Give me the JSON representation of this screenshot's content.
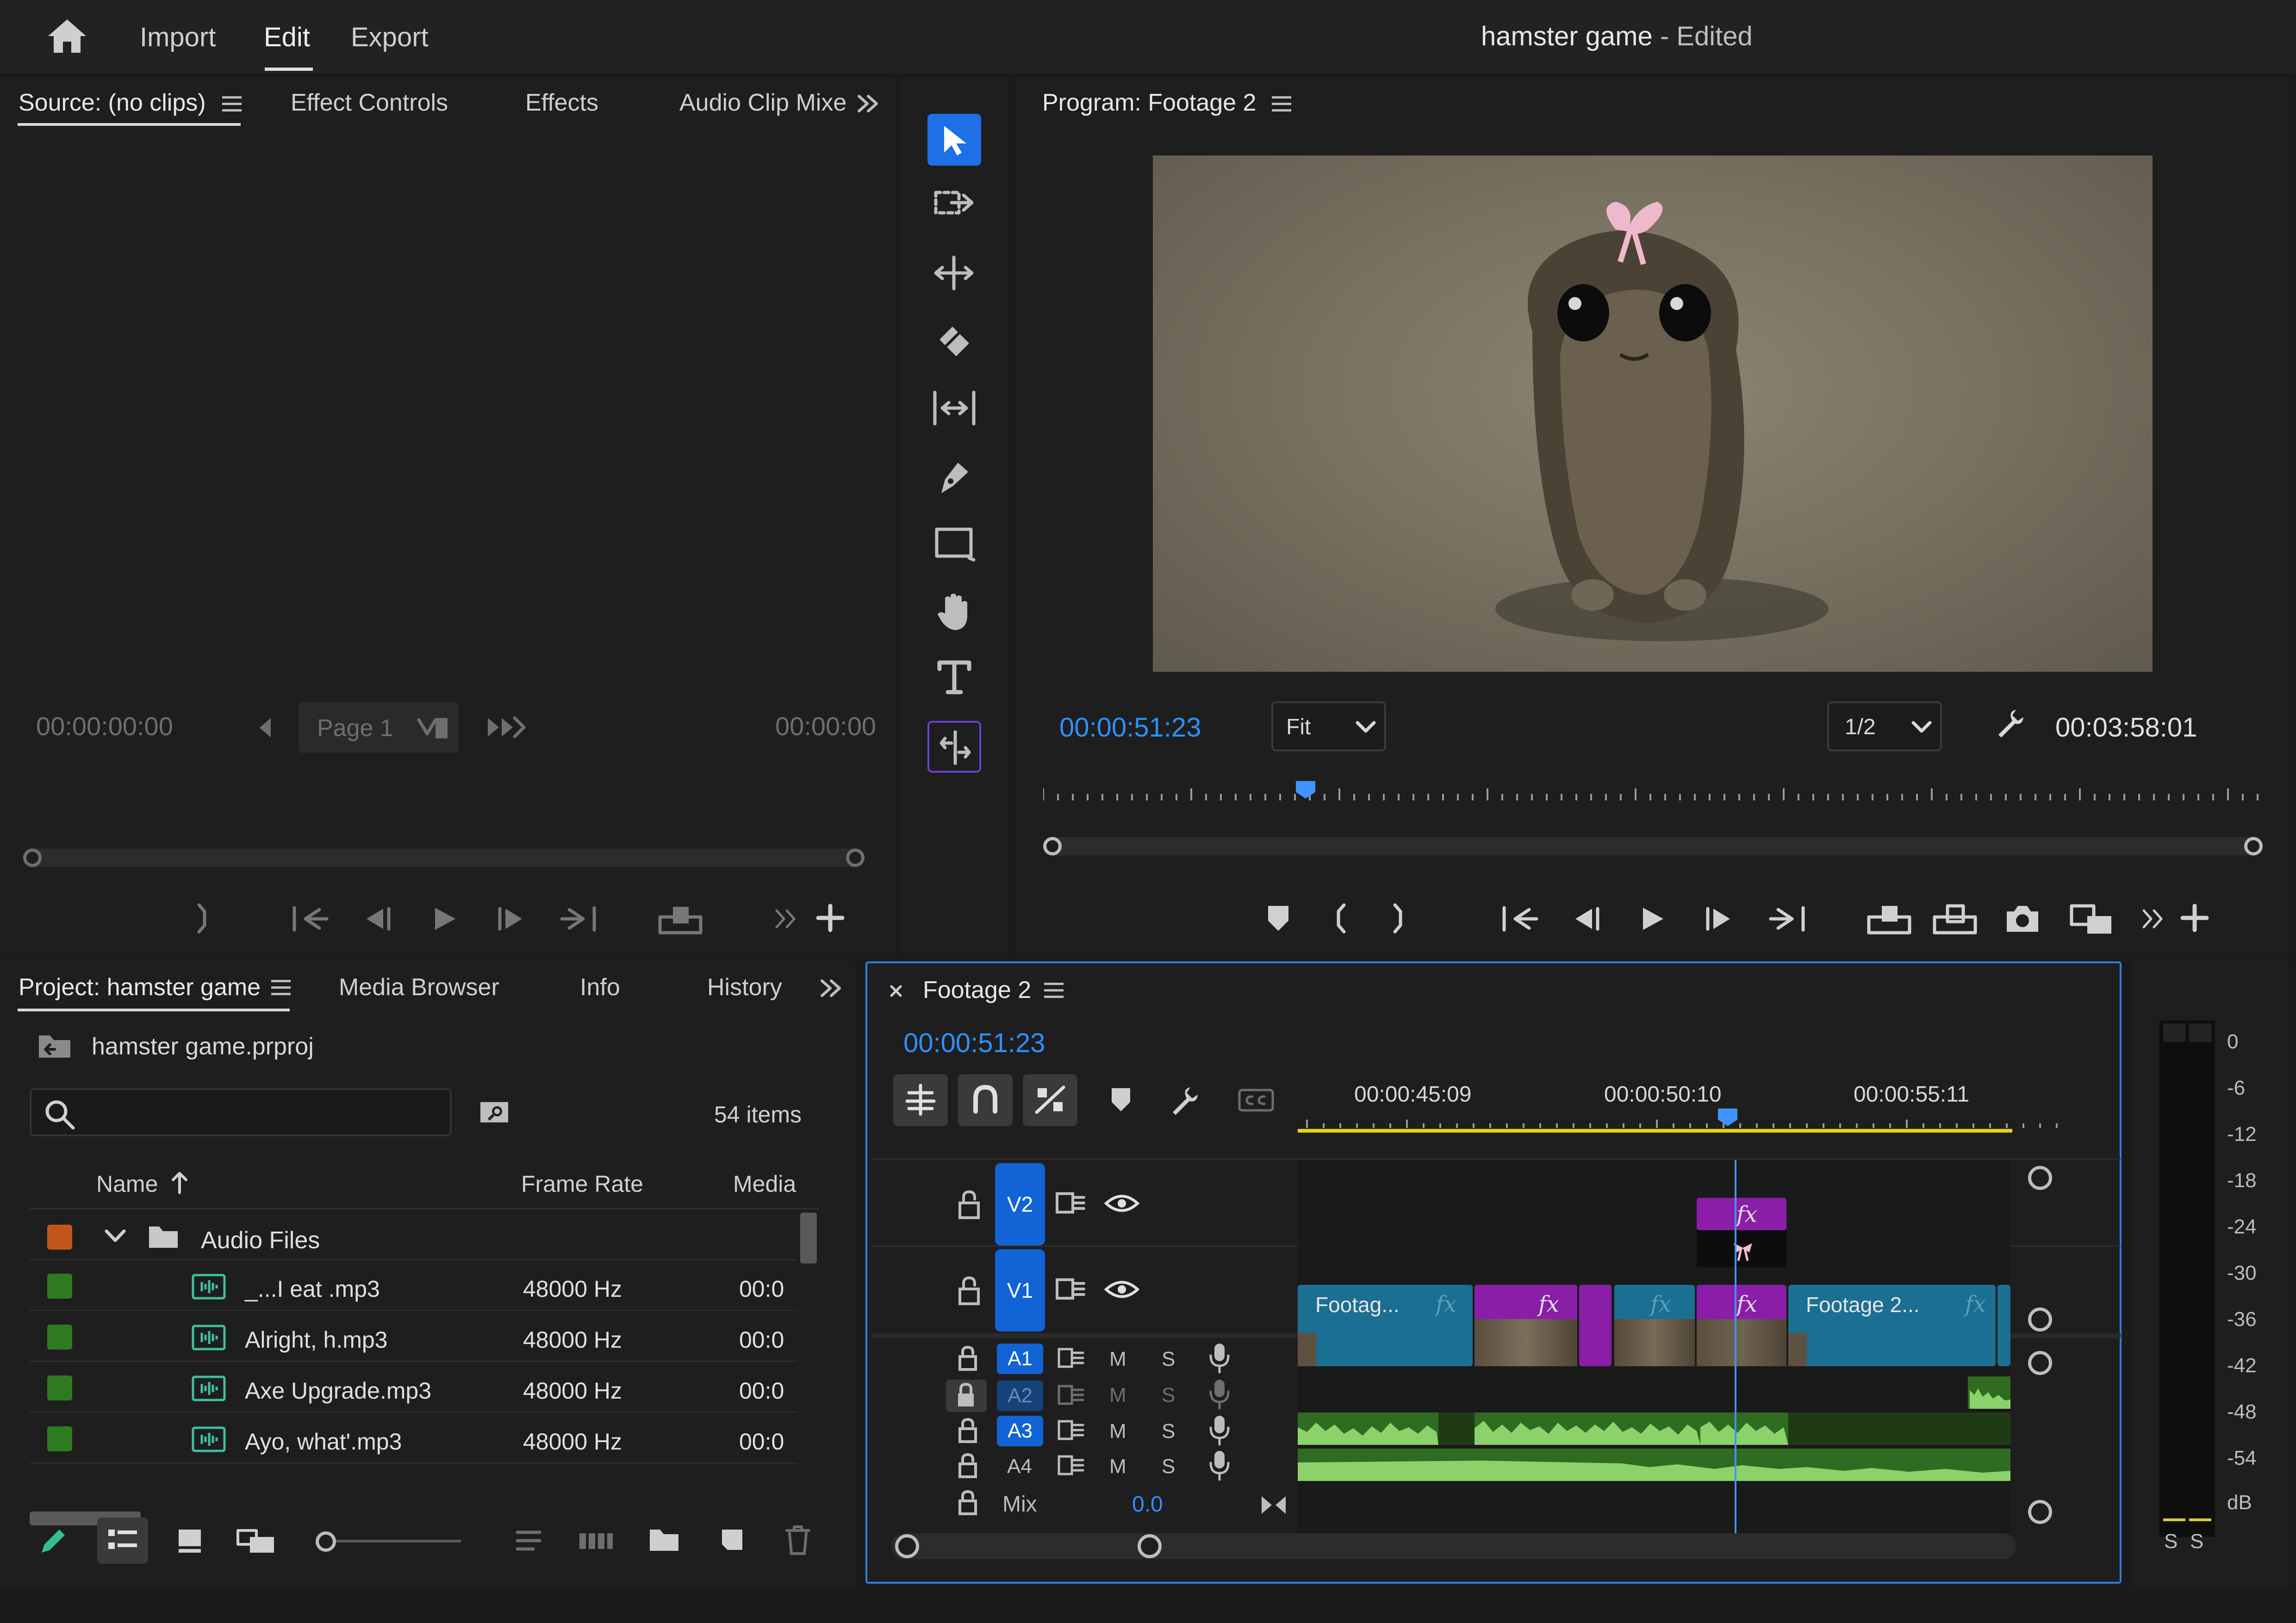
{
  "header": {
    "home_icon": "home-icon",
    "menu": [
      "Import",
      "Edit",
      "Export"
    ],
    "active": "Edit",
    "project_name": "hamster game",
    "status": "- Edited"
  },
  "source_panel": {
    "tabs": [
      "Source: (no clips)",
      "Effect Controls",
      "Effects",
      "Audio Clip Mixe"
    ],
    "timecode_left": "00:00:00:00",
    "timecode_right": "00:00:00",
    "page_select": "Page 1"
  },
  "program_panel": {
    "title": "Program: Footage 2",
    "timecode": "00:00:51:23",
    "fit": "Fit",
    "resolution": "1/2",
    "duration": "00:03:58:01"
  },
  "project_panel": {
    "tabs": [
      "Project: hamster game",
      "Media Browser",
      "Info",
      "History"
    ],
    "file": "hamster game.prproj",
    "search_placeholder": "",
    "item_count": "54 items",
    "columns": [
      "Name",
      "Frame Rate",
      "Media"
    ],
    "folder": "Audio Files",
    "rows": [
      {
        "name": "_...I eat .mp3",
        "rate": "48000 Hz",
        "media": "00:0"
      },
      {
        "name": "Alright, h.mp3",
        "rate": "48000 Hz",
        "media": "00:0"
      },
      {
        "name": "Axe Upgrade.mp3",
        "rate": "48000 Hz",
        "media": "00:0"
      },
      {
        "name": "Ayo, what'.mp3",
        "rate": "48000 Hz",
        "media": "00:0"
      }
    ],
    "colors": {
      "folder_label": "#c0561b",
      "item_label": "#2e7a21"
    }
  },
  "timeline": {
    "sequence": "Footage 2",
    "timecode": "00:00:51:23",
    "ruler": [
      "00:00:45:09",
      "00:00:50:10",
      "00:00:55:11"
    ],
    "video_tracks": [
      "V2",
      "V1"
    ],
    "audio_tracks": [
      "A1",
      "A2",
      "A3",
      "A4"
    ],
    "mute": "M",
    "solo": "S",
    "mix_label": "Mix",
    "mix_value": "0.0",
    "clips": {
      "c1": "Footag...",
      "c2": "Footage 2...",
      "fx": "fx"
    }
  },
  "meter": {
    "scale": [
      "0",
      "-6",
      "-12",
      "-18",
      "-24",
      "-30",
      "-36",
      "-42",
      "-48",
      "-54",
      "dB"
    ],
    "solo_buttons": [
      "S",
      "S"
    ]
  }
}
